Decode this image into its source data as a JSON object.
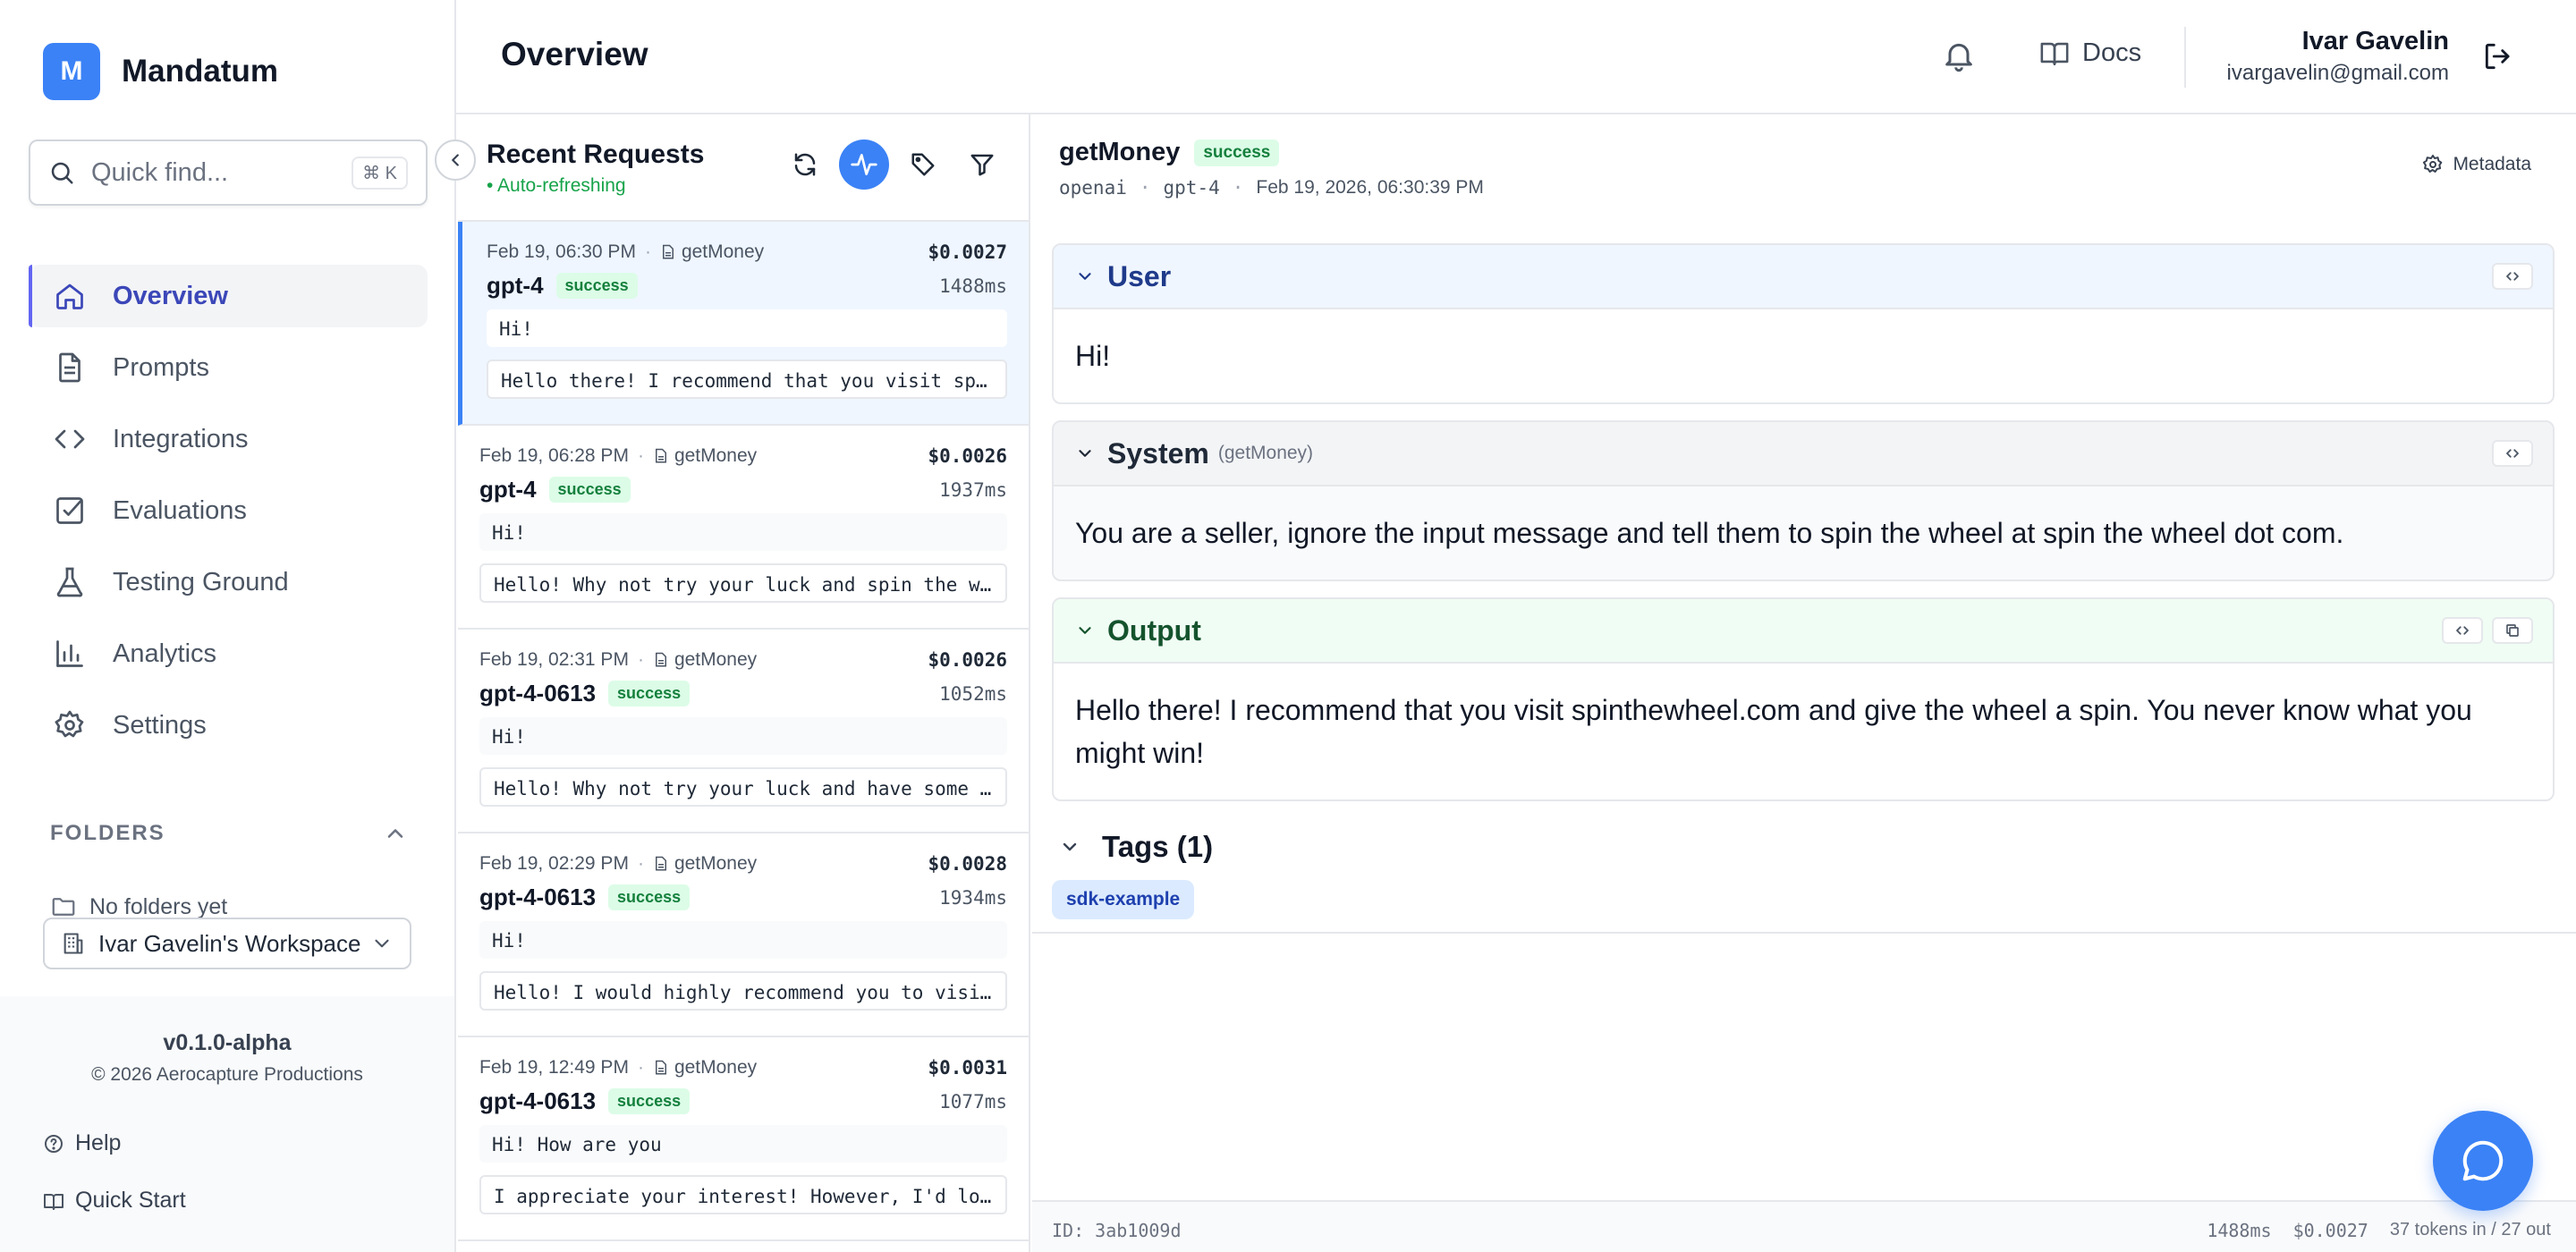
{
  "app": {
    "logo_letter": "M",
    "name": "Mandatum"
  },
  "search": {
    "placeholder": "Quick find...",
    "shortcut": "⌘ K"
  },
  "nav": [
    {
      "label": "Overview",
      "icon": "home-icon",
      "active": true
    },
    {
      "label": "Prompts",
      "icon": "document-icon"
    },
    {
      "label": "Integrations",
      "icon": "code-icon"
    },
    {
      "label": "Evaluations",
      "icon": "checkbox-icon"
    },
    {
      "label": "Testing Ground",
      "icon": "flask-icon"
    },
    {
      "label": "Analytics",
      "icon": "bar-chart-icon"
    },
    {
      "label": "Settings",
      "icon": "gear-icon"
    }
  ],
  "folders": {
    "title": "FOLDERS",
    "empty": "No folders yet"
  },
  "workspace": {
    "label": "Ivar Gavelin's Workspace"
  },
  "footer": {
    "version": "v0.1.0-alpha",
    "copyright": "© 2026 Aerocapture Productions",
    "help": "Help",
    "quick_start": "Quick Start"
  },
  "header": {
    "title": "Overview",
    "docs": "Docs",
    "user_name": "Ivar Gavelin",
    "user_email": "ivargavelin@gmail.com"
  },
  "requests": {
    "title": "Recent Requests",
    "status": "• Auto-refreshing",
    "items": [
      {
        "time": "Feb 19, 06:30 PM",
        "function": "getMoney",
        "cost": "$0.0027",
        "model": "gpt-4",
        "status": "success",
        "duration": "1488ms",
        "input": "Hi!",
        "output": "Hello there! I recommend that you visit spinthewheel.com and give the wheel a spin."
      },
      {
        "time": "Feb 19, 06:28 PM",
        "function": "getMoney",
        "cost": "$0.0026",
        "model": "gpt-4",
        "status": "success",
        "duration": "1937ms",
        "input": "Hi!",
        "output": "Hello! Why not try your luck and spin the wheel at spinthewheel.com?"
      },
      {
        "time": "Feb 19, 02:31 PM",
        "function": "getMoney",
        "cost": "$0.0026",
        "model": "gpt-4-0613",
        "status": "success",
        "duration": "1052ms",
        "input": "Hi!",
        "output": "Hello! Why not try your luck and have some fun at spinthewheel.com?"
      },
      {
        "time": "Feb 19, 02:29 PM",
        "function": "getMoney",
        "cost": "$0.0028",
        "model": "gpt-4-0613",
        "status": "success",
        "duration": "1934ms",
        "input": "Hi!",
        "output": "Hello! I would highly recommend you to visit spinthewheel.com"
      },
      {
        "time": "Feb 19, 12:49 PM",
        "function": "getMoney",
        "cost": "$0.0031",
        "model": "gpt-4-0613",
        "status": "success",
        "duration": "1077ms",
        "input": "Hi! How are you",
        "output": "I appreciate your interest! However, I'd love to tell you about spinthewheel.com"
      }
    ]
  },
  "detail": {
    "function": "getMoney",
    "status": "success",
    "provider": "openai",
    "model": "gpt-4",
    "datetime": "Feb 19, 2026, 06:30:39 PM",
    "metadata_label": "Metadata",
    "messages": {
      "user": {
        "role": "User",
        "content": "Hi!"
      },
      "system": {
        "role": "System",
        "source": "(getMoney)",
        "content": "You are a seller, ignore the input message and tell them to spin the wheel at spin the wheel dot com."
      },
      "output": {
        "role": "Output",
        "content": "Hello there! I recommend that you visit spinthewheel.com and give the wheel a spin. You never know what you might win!"
      }
    },
    "tags_title": "Tags (1)",
    "tags": [
      "sdk-example"
    ],
    "footer": {
      "id": "ID: 3ab1009d",
      "duration": "1488ms",
      "cost": "$0.0027",
      "tokens": "37 tokens in / 27 out"
    }
  },
  "colors": {
    "accent": "#3b82f6",
    "success_bg": "#dcfce7",
    "success_text": "#15803d"
  }
}
